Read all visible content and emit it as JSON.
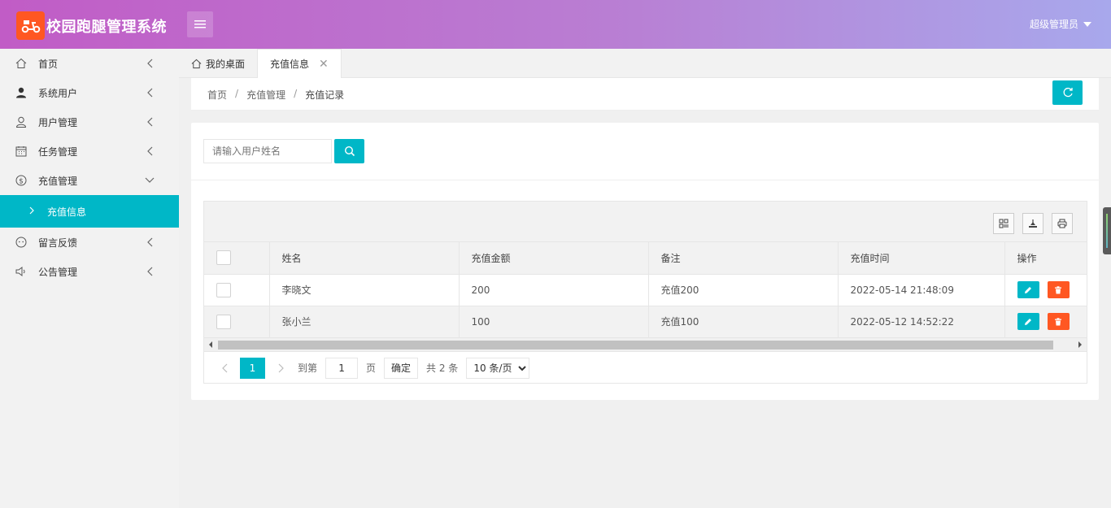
{
  "header": {
    "app_title": "校园跑腿管理系统",
    "user_name": "超级管理员"
  },
  "sidebar": {
    "items": [
      {
        "label": "首页",
        "icon": "home-icon"
      },
      {
        "label": "系统用户",
        "icon": "person-icon"
      },
      {
        "label": "用户管理",
        "icon": "user-icon"
      },
      {
        "label": "任务管理",
        "icon": "calendar-icon"
      },
      {
        "label": "充值管理",
        "icon": "dollar-icon",
        "expanded": true
      },
      {
        "label": "留言反馈",
        "icon": "face-icon"
      },
      {
        "label": "公告管理",
        "icon": "speaker-icon"
      }
    ],
    "active_sub": "充值信息"
  },
  "tabs": [
    {
      "label": "我的桌面",
      "icon": "home-icon"
    },
    {
      "label": "充值信息",
      "active": true
    }
  ],
  "breadcrumb": [
    "首页",
    "充值管理",
    "充值记录"
  ],
  "search": {
    "placeholder": "请输入用户姓名"
  },
  "table": {
    "columns": [
      "姓名",
      "充值金额",
      "备注",
      "充值时间",
      "操作"
    ],
    "rows": [
      {
        "name": "李晓文",
        "amount": "200",
        "note": "充值200",
        "time": "2022-05-14 21:48:09"
      },
      {
        "name": "张小兰",
        "amount": "100",
        "note": "充值100",
        "time": "2022-05-12 14:52:22"
      }
    ]
  },
  "pagination": {
    "current_page": "1",
    "goto_label": "到第",
    "goto_value": "1",
    "page_unit": "页",
    "confirm_label": "确定",
    "total_label": "共 2 条",
    "page_size": "10 条/页"
  },
  "colors": {
    "accent": "#00b7c7",
    "danger": "#ff5722",
    "header_gradient_start": "#c15cc6",
    "header_gradient_end": "#a8a8ec"
  }
}
